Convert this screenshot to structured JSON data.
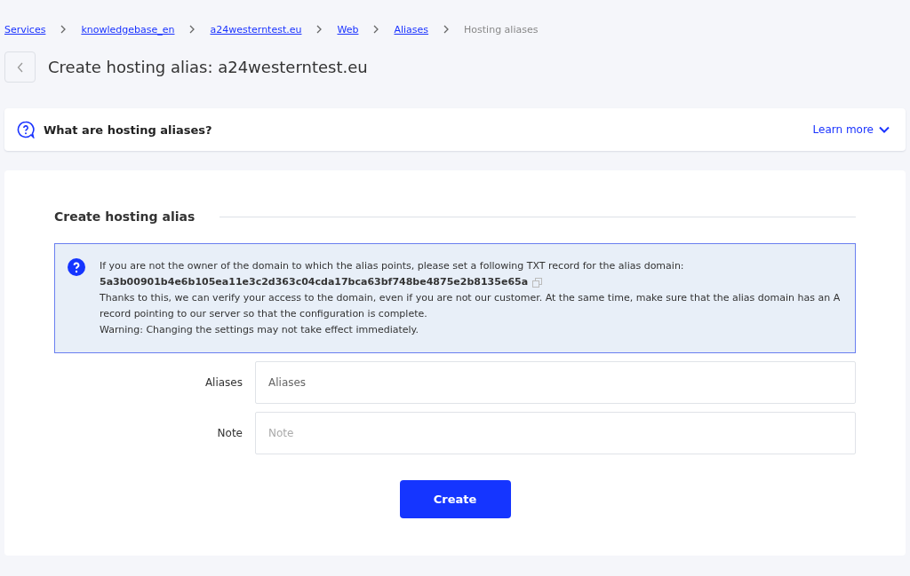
{
  "breadcrumbs": [
    {
      "label": "Services",
      "kind": "link"
    },
    {
      "label": "knowledgebase_en",
      "kind": "link"
    },
    {
      "label": "a24westerntest.eu",
      "kind": "link"
    },
    {
      "label": "Web",
      "kind": "link"
    },
    {
      "label": "Aliases",
      "kind": "link"
    },
    {
      "label": "Hosting aliases",
      "kind": "current"
    }
  ],
  "page_title": "Create hosting alias: a24westerntest.eu",
  "help_panel": {
    "title": "What are hosting aliases?",
    "link": "Learn more",
    "expanded": false
  },
  "form": {
    "section_title": "Create hosting alias",
    "notice": {
      "intro": "If you are not the owner of the domain to which the alias points, please set a following TXT record for the alias domain:",
      "record": "5a3b00901b4e6b105ea11e3c2d363c04cda17bca63bf748be4875e2b8135e65a",
      "body": "Thanks to this, we can verify your access to the domain, even if you are not our customer. At the same time, make sure that the alias domain has an A record pointing to our server so that the configuration is complete.",
      "warning": "Warning: Changing the settings may not take effect immediately."
    },
    "fields": [
      {
        "label": "Aliases",
        "placeholder": "Aliases",
        "kind": "tags"
      },
      {
        "label": "Note",
        "placeholder": "Note",
        "kind": "text"
      }
    ],
    "submit": "Create"
  }
}
